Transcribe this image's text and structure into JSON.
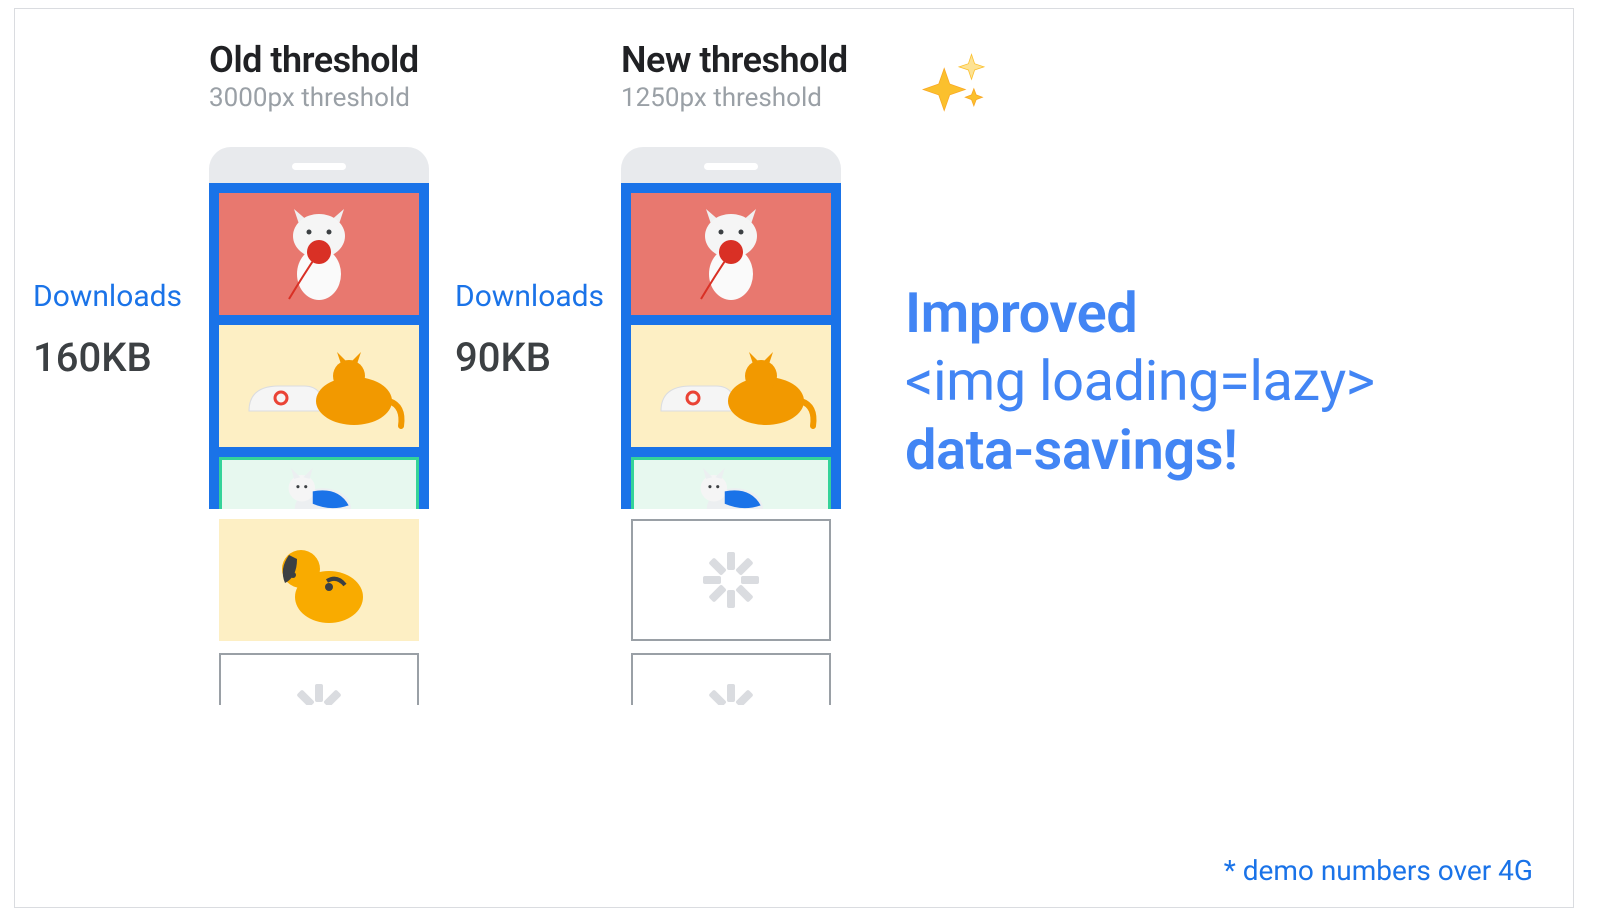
{
  "left": {
    "title": "Old threshold",
    "subtitle": "3000px threshold",
    "downloads_label": "Downloads",
    "size": "160KB",
    "tiles": [
      "cat-yarn",
      "cat-sneaker",
      "cat-cape",
      "dog",
      "placeholder"
    ]
  },
  "right": {
    "title": "New threshold",
    "subtitle": "1250px threshold",
    "downloads_label": "Downloads",
    "size": "90KB",
    "tiles": [
      "cat-yarn",
      "cat-sneaker",
      "cat-cape",
      "placeholder",
      "placeholder"
    ]
  },
  "headline": {
    "line1": "Improved",
    "line2": "<img loading=lazy>",
    "line3": "data-savings!"
  },
  "footnote": "* demo numbers over 4G",
  "icons": {
    "sparkle": "sparkle-icon"
  }
}
